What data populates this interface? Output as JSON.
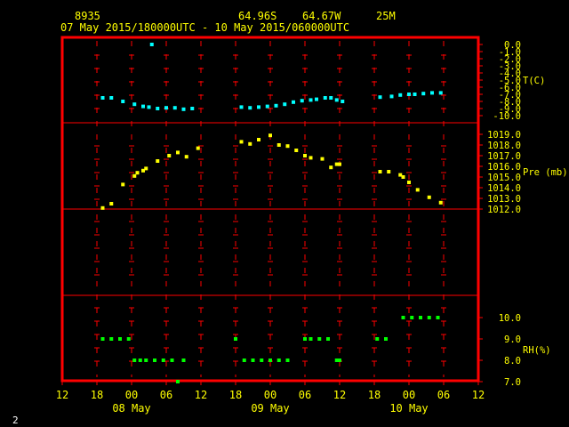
{
  "header": {
    "station": "8935",
    "lat": "64.96S",
    "lon": "64.67W",
    "elev": "25M",
    "period": "07 May 2015/180000UTC - 10 May 2015/060000UTC"
  },
  "footer": {
    "page": "2"
  },
  "colors": {
    "background": "#000000",
    "frame": "#ff0000",
    "tick": "#ff0000",
    "axis_label": "#ffff00",
    "temp": "#00ffff",
    "pressure": "#ffff00",
    "rh": "#00ff00"
  },
  "chart_data": {
    "type": "scatter",
    "x_axis": {
      "unit": "hours since 07 May 2015 12 UTC",
      "range": [
        0,
        72
      ],
      "ticks": [
        {
          "x": 0,
          "label": "12"
        },
        {
          "x": 6,
          "label": "18"
        },
        {
          "x": 12,
          "label": "00"
        },
        {
          "x": 18,
          "label": "06"
        },
        {
          "x": 24,
          "label": "12"
        },
        {
          "x": 30,
          "label": "18"
        },
        {
          "x": 36,
          "label": "00"
        },
        {
          "x": 42,
          "label": "06"
        },
        {
          "x": 48,
          "label": "12"
        },
        {
          "x": 54,
          "label": "18"
        },
        {
          "x": 60,
          "label": "00"
        },
        {
          "x": 66,
          "label": "06"
        },
        {
          "x": 72,
          "label": "12"
        }
      ],
      "day_labels": [
        {
          "x": 12,
          "label": "08 May"
        },
        {
          "x": 36,
          "label": "09 May"
        },
        {
          "x": 60,
          "label": "10 May"
        }
      ]
    },
    "panels": [
      {
        "name": "T(C)",
        "ylim": [
          -10,
          0
        ],
        "tick_labels": [
          "0.0",
          "-1.0",
          "-2.0",
          "-3.0",
          "-4.0",
          "-5.0",
          "-6.0",
          "-7.0",
          "-8.0",
          "-9.0",
          "-10.0"
        ],
        "tick_values": [
          0,
          -1,
          -2,
          -3,
          -4,
          -5,
          -6,
          -7,
          -8,
          -9,
          -10
        ],
        "color_key": "temp",
        "points": [
          [
            7,
            -7.5
          ],
          [
            8.5,
            -7.5
          ],
          [
            10.5,
            -8.0
          ],
          [
            12.5,
            -8.4
          ],
          [
            14,
            -8.7
          ],
          [
            15,
            -8.8
          ],
          [
            16.5,
            -9.0
          ],
          [
            18,
            -8.9
          ],
          [
            19.5,
            -8.9
          ],
          [
            21,
            -9.1
          ],
          [
            22.5,
            -9.0
          ],
          [
            15.5,
            0.0
          ],
          [
            31,
            -8.8
          ],
          [
            32.5,
            -8.9
          ],
          [
            34,
            -8.8
          ],
          [
            35.5,
            -8.7
          ],
          [
            37,
            -8.6
          ],
          [
            38.5,
            -8.4
          ],
          [
            40,
            -8.1
          ],
          [
            41.5,
            -7.9
          ],
          [
            43,
            -7.8
          ],
          [
            44,
            -7.7
          ],
          [
            45.5,
            -7.5
          ],
          [
            46.5,
            -7.5
          ],
          [
            47.5,
            -7.8
          ],
          [
            48.5,
            -8.0
          ],
          [
            55,
            -7.4
          ],
          [
            57,
            -7.3
          ],
          [
            58.5,
            -7.1
          ],
          [
            60,
            -7.0
          ],
          [
            61,
            -7.0
          ],
          [
            62.5,
            -6.9
          ],
          [
            64,
            -6.8
          ],
          [
            65.5,
            -6.8
          ]
        ]
      },
      {
        "name": "Pre (mb)",
        "ylim": [
          1012,
          1020
        ],
        "tick_labels": [
          "1019.0",
          "1018.0",
          "1017.0",
          "1016.0",
          "1015.0",
          "1014.0",
          "1013.0",
          "1012.0"
        ],
        "tick_values": [
          1019,
          1018,
          1017,
          1016,
          1015,
          1014,
          1013,
          1012
        ],
        "color_key": "pressure",
        "points": [
          [
            7,
            1012.1
          ],
          [
            8.5,
            1012.5
          ],
          [
            10.5,
            1014.3
          ],
          [
            12.5,
            1015.1
          ],
          [
            13,
            1015.4
          ],
          [
            14,
            1015.6
          ],
          [
            14.5,
            1015.8
          ],
          [
            16.5,
            1016.5
          ],
          [
            18.5,
            1017.0
          ],
          [
            20,
            1017.3
          ],
          [
            21.5,
            1016.9
          ],
          [
            23.5,
            1017.7
          ],
          [
            31,
            1018.3
          ],
          [
            32.5,
            1018.1
          ],
          [
            34,
            1018.5
          ],
          [
            36,
            1018.9
          ],
          [
            37.5,
            1018.0
          ],
          [
            39,
            1017.9
          ],
          [
            40.5,
            1017.5
          ],
          [
            42,
            1017.0
          ],
          [
            43,
            1016.8
          ],
          [
            45,
            1016.7
          ],
          [
            46.5,
            1015.9
          ],
          [
            47.5,
            1016.2
          ],
          [
            48,
            1016.2
          ],
          [
            55,
            1015.5
          ],
          [
            56.5,
            1015.5
          ],
          [
            58.5,
            1015.2
          ],
          [
            59,
            1015.0
          ],
          [
            60,
            1014.5
          ],
          [
            61.5,
            1013.8
          ],
          [
            63.5,
            1013.1
          ],
          [
            65.5,
            1012.6
          ]
        ]
      },
      {
        "name": "RH(%)",
        "ylim": [
          7.0,
          10.0
        ],
        "tick_labels": [
          "10.0",
          "9.0",
          "8.0",
          "7.0"
        ],
        "tick_values": [
          10,
          9,
          8,
          7
        ],
        "color_key": "rh",
        "points": [
          [
            7,
            9.0
          ],
          [
            8.5,
            9.0
          ],
          [
            10,
            9.0
          ],
          [
            11.5,
            9.0
          ],
          [
            12.5,
            8.0
          ],
          [
            13.5,
            8.0
          ],
          [
            14.5,
            8.0
          ],
          [
            16,
            8.0
          ],
          [
            17.5,
            8.0
          ],
          [
            19,
            8.0
          ],
          [
            20,
            7.0
          ],
          [
            21,
            8.0
          ],
          [
            30,
            9.0
          ],
          [
            31.5,
            8.0
          ],
          [
            33,
            8.0
          ],
          [
            34.5,
            8.0
          ],
          [
            36,
            8.0
          ],
          [
            37.5,
            8.0
          ],
          [
            39,
            8.0
          ],
          [
            42,
            9.0
          ],
          [
            43,
            9.0
          ],
          [
            44.5,
            9.0
          ],
          [
            46,
            9.0
          ],
          [
            47.5,
            8.0
          ],
          [
            48,
            8.0
          ],
          [
            54.5,
            9.0
          ],
          [
            56,
            9.0
          ],
          [
            59,
            10.0
          ],
          [
            60.5,
            10.0
          ],
          [
            62,
            10.0
          ],
          [
            63.5,
            10.0
          ],
          [
            65,
            10.0
          ]
        ]
      }
    ]
  }
}
